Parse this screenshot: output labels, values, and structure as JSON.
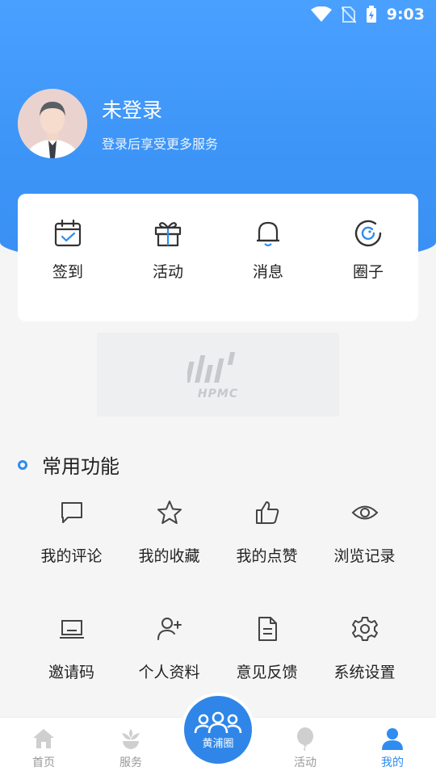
{
  "status_bar": {
    "time": "9:03"
  },
  "profile": {
    "name": "未登录",
    "subtitle": "登录后享受更多服务"
  },
  "quick_actions": [
    {
      "label": "签到",
      "icon": "calendar-check-icon"
    },
    {
      "label": "活动",
      "icon": "gift-icon"
    },
    {
      "label": "消息",
      "icon": "bell-icon"
    },
    {
      "label": "圈子",
      "icon": "circle-refresh-icon"
    }
  ],
  "banner": {
    "text": "HPMC"
  },
  "section": {
    "title": "常用功能"
  },
  "functions": [
    {
      "label": "我的评论",
      "icon": "comment-icon"
    },
    {
      "label": "我的收藏",
      "icon": "star-icon"
    },
    {
      "label": "我的点赞",
      "icon": "thumbs-up-icon"
    },
    {
      "label": "浏览记录",
      "icon": "eye-icon"
    },
    {
      "label": "邀请码",
      "icon": "invite-code-icon"
    },
    {
      "label": "个人资料",
      "icon": "user-add-icon"
    },
    {
      "label": "意见反馈",
      "icon": "document-icon"
    },
    {
      "label": "系统设置",
      "icon": "gear-icon"
    }
  ],
  "tabbar": {
    "home": "首页",
    "services": "服务",
    "center": "黄浦圈",
    "activities": "活动",
    "mine": "我的"
  },
  "colors": {
    "accent": "#2f8cf0",
    "hero": "#3d95f7"
  }
}
